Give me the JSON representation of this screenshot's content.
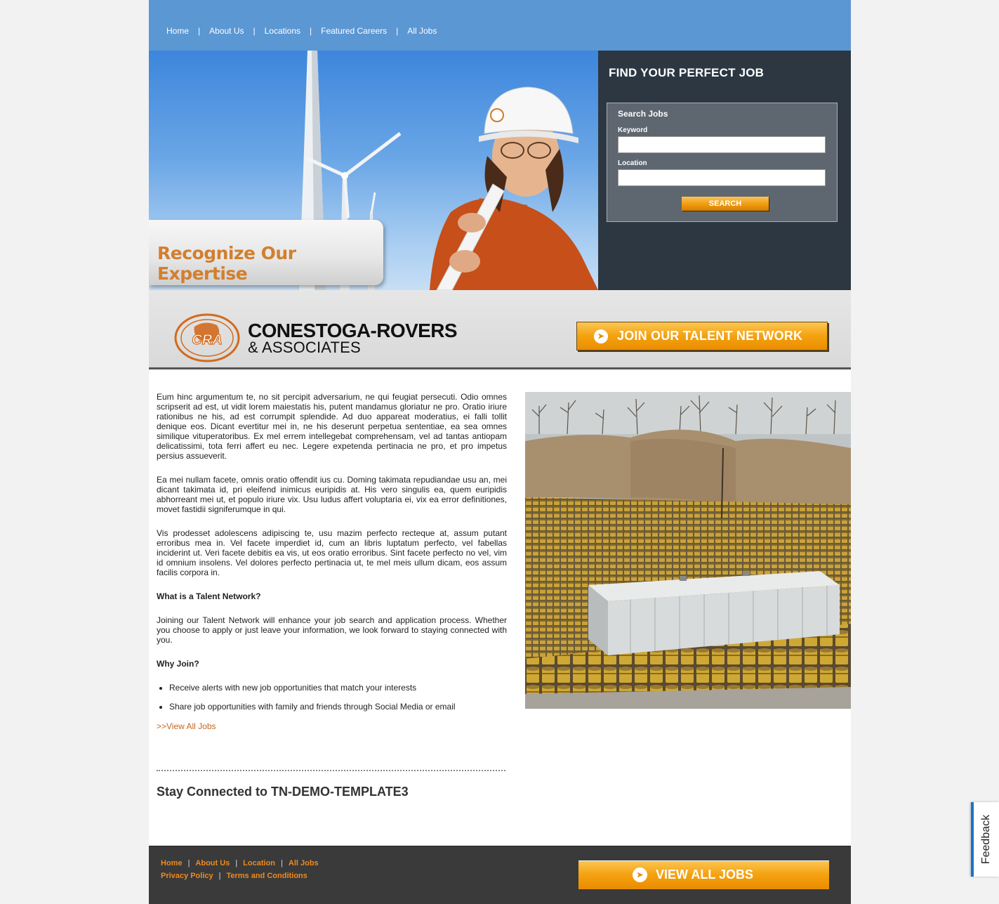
{
  "nav": {
    "items": [
      {
        "label": "Home"
      },
      {
        "label": "About Us"
      },
      {
        "label": "Locations"
      },
      {
        "label": "Featured Careers"
      },
      {
        "label": "All Jobs"
      }
    ],
    "separator": "|"
  },
  "hero": {
    "banner_text": "Recognize Our Expertise"
  },
  "search": {
    "heading": "FIND YOUR PERFECT JOB",
    "box_title": "Search Jobs",
    "keyword_label": "Keyword",
    "keyword_value": "",
    "location_label": "Location",
    "location_value": "",
    "button_label": "SEARCH"
  },
  "brand": {
    "logo_text": "CRA",
    "name_line1": "CONESTOGA-ROVERS",
    "name_line2": "& ASSOCIATES",
    "join_button": "JOIN OUR TALENT NETWORK"
  },
  "content": {
    "p1": "Eum hinc argumentum te, no sit percipit adversarium, ne qui feugiat persecuti. Odio omnes scripserit ad est, ut vidit lorem maiestatis his, putent mandamus gloriatur ne pro. Oratio iriure rationibus ne his, ad est corrumpit splendide. Ad duo appareat moderatius, ei falli tollit denique eos. Dicant evertitur mei in, ne his deserunt perpetua sententiae, ea sea omnes similique vituperatoribus. Ex mel errem intellegebat comprehensam, vel ad tantas antiopam delicatissimi, tota ferri affert eu nec. Legere expetenda pertinacia ne pro, et pro impetus persius assueverit.",
    "p2": "Ea mei nullam facete, omnis oratio offendit ius cu. Doming takimata repudiandae usu an, mei dicant takimata id, pri eleifend inimicus euripidis at. His vero singulis ea, quem euripidis abhorreant mei ut, et populo iriure vix. Usu ludus affert voluptaria ei, vix ea error definitiones, movet fastidii signiferumque in qui.",
    "p3": "Vis prodesset adolescens adipiscing te, usu mazim perfecto recteque at, assum putant erroribus mea in. Vel facete imperdiet id, cum an libris luptatum perfecto, vel fabellas inciderint ut. Veri facete debitis ea vis, ut eos oratio erroribus. Sint facete perfecto no vel, vim id omnium insolens. Vel dolores perfecto pertinacia ut, te mel meis ullum dicam, eos assum facilis corpora in.",
    "h_what": "What is a Talent Network?",
    "p_what": "Joining our Talent Network will enhance your job search and application process. Whether you choose to apply or just leave your information, we look forward to staying connected with you.",
    "h_why": "Why Join?",
    "bullets": [
      "Receive alerts with new job opportunities that match your interests",
      "Share job opportunities with family and friends through Social Media or email"
    ],
    "view_all_link": ">>View All Jobs",
    "stay_connected": "Stay Connected to TN-DEMO-TEMPLATE3"
  },
  "footer": {
    "row1": [
      "Home",
      "About Us",
      "Location",
      "All Jobs"
    ],
    "row2": [
      "Privacy Policy",
      "Terms and Conditions"
    ],
    "separator": "|",
    "view_all_button": "VIEW ALL JOBS"
  },
  "feedback": {
    "label": "Feedback"
  },
  "colors": {
    "nav_bg": "#5b97d3",
    "panel_bg": "#2c3742",
    "accent_orange": "#f4a110",
    "link_orange": "#c4661f",
    "footer_bg": "#3a3a3a"
  }
}
